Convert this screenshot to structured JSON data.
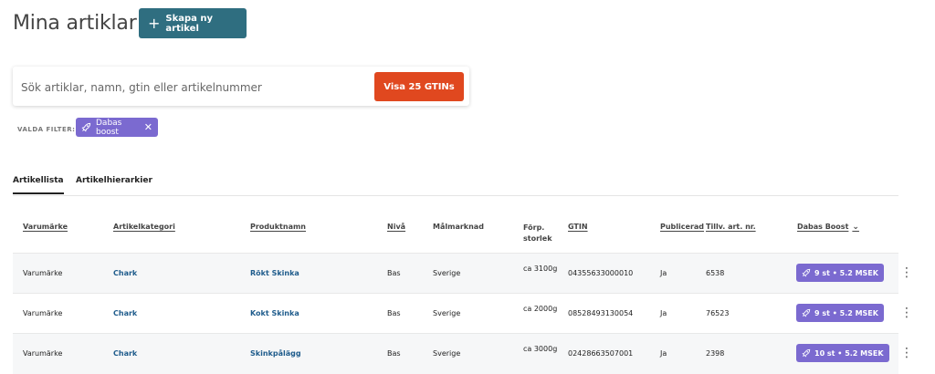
{
  "page": {
    "title": "Mina artiklar",
    "create_button": "Skapa ny artikel"
  },
  "search": {
    "placeholder": "Sök artiklar, namn, gtin eller artikelnummer",
    "gtin_button": "Visa 25 GTINs"
  },
  "filters": {
    "label": "VALDA FILTER:",
    "chips": [
      {
        "label": "Dabas boost"
      }
    ]
  },
  "tabs": [
    {
      "label": "Artikellista",
      "active": true
    },
    {
      "label": "Artikelhierarkier",
      "active": false
    }
  ],
  "table": {
    "headers": {
      "brand": "Varumärke",
      "category": "Artikelkategori",
      "product": "Produktnamn",
      "level": "Nivå",
      "market": "Målmarknad",
      "pack": "Förp. storlek",
      "gtin": "GTIN",
      "published": "Publicerad",
      "art_nr": "Tillv. art. nr.",
      "boost": "Dabas Boost"
    },
    "rows": [
      {
        "brand": "Varumärke",
        "category": "Chark",
        "product": "Rökt Skinka",
        "level": "Bas",
        "market": "Sverige",
        "pack": "ca 3100g",
        "gtin": "04355633000010",
        "published": "Ja",
        "art_nr": "6538",
        "boost": "9 st • 5.2 MSEK"
      },
      {
        "brand": "Varumärke",
        "category": "Chark",
        "product": "Kokt Skinka",
        "level": "Bas",
        "market": "Sverige",
        "pack": "ca 2000g",
        "gtin": "08528493130054",
        "published": "Ja",
        "art_nr": "76523",
        "boost": "9 st • 5.2 MSEK"
      },
      {
        "brand": "Varumärke",
        "category": "Chark",
        "product": "Skinkpålägg",
        "level": "Bas",
        "market": "Sverige",
        "pack": "ca 3000g",
        "gtin": "02428663507001",
        "published": "Ja",
        "art_nr": "2398",
        "boost": "10 st • 5.2 MSEK"
      }
    ]
  },
  "colors": {
    "primary": "#2f6e80",
    "accent": "#e0481f",
    "boost": "#7b6ad0",
    "link": "#1f5c8c"
  },
  "icons": {
    "create": "plus-icon",
    "chip": "rocket-icon",
    "chip_remove": "close-icon",
    "sort": "chevron-down-icon",
    "row_menu": "more-vertical-icon"
  }
}
